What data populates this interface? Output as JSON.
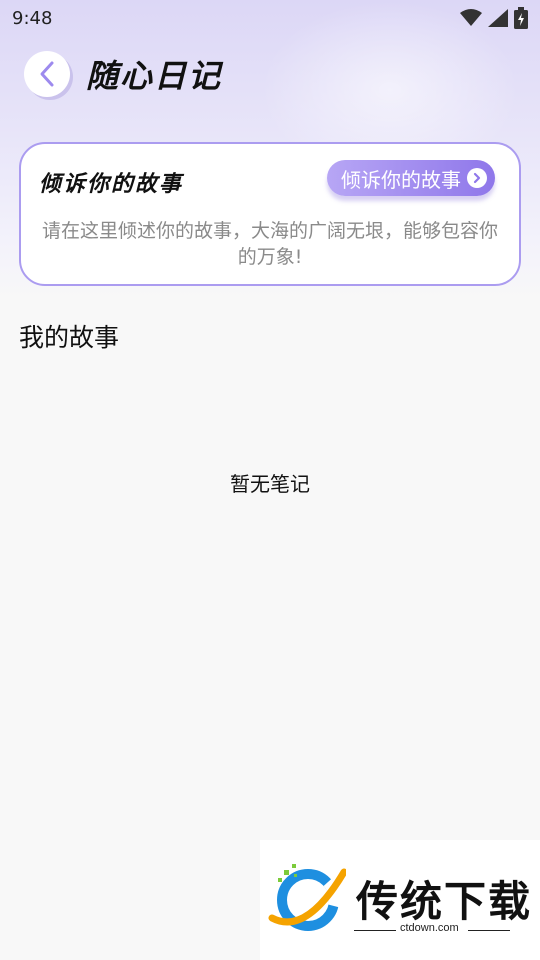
{
  "status_bar": {
    "time": "9:48"
  },
  "header": {
    "title": "随心日记"
  },
  "story_card": {
    "title": "倾诉你的故事",
    "button_label": "倾诉你的故事",
    "description": "请在这里倾述你的故事，大海的广阔无垠，能够包容你的万象!"
  },
  "my_stories": {
    "section_title": "我的故事",
    "empty_text": "暂无笔记"
  },
  "watermark": {
    "brand": "传统下载",
    "url": "ctdown.com"
  },
  "colors": {
    "accent": "#9580ec",
    "card_border": "#ab9cf0",
    "background": "#f8f8f8"
  },
  "icons": [
    "wifi-icon",
    "signal-icon",
    "battery-icon",
    "back-arrow-icon",
    "chevron-right-icon",
    "ctdown-logo-icon"
  ]
}
